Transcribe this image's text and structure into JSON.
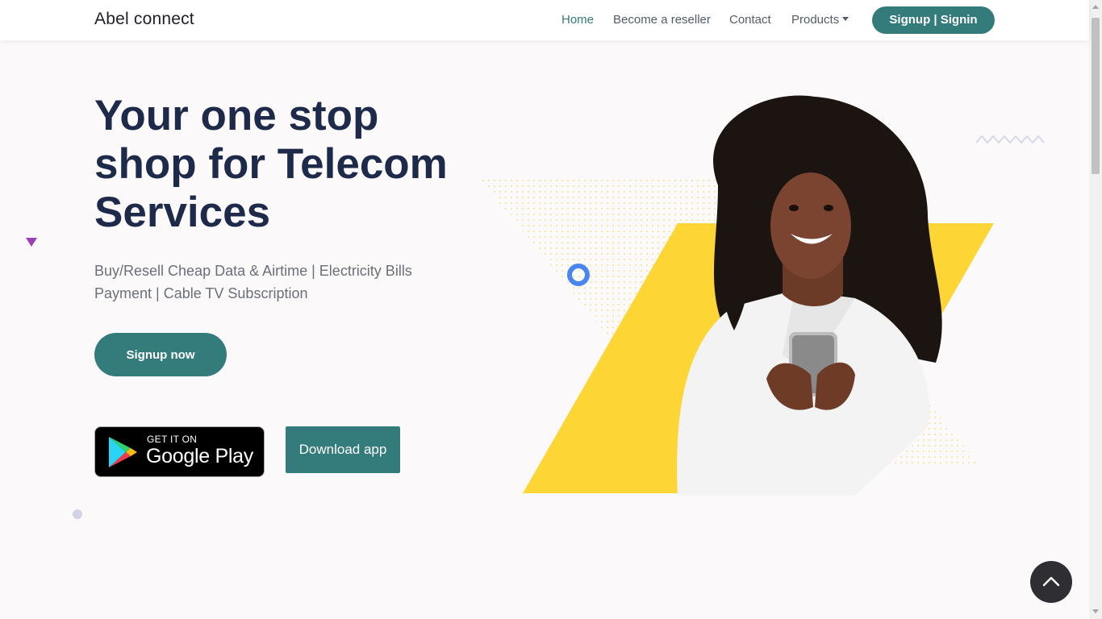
{
  "nav": {
    "brand": "Abel connect",
    "links": [
      {
        "label": "Home",
        "active": true
      },
      {
        "label": "Become a reseller"
      },
      {
        "label": "Contact"
      },
      {
        "label": "Products"
      }
    ],
    "cta": "Signup | Signin"
  },
  "hero": {
    "title_line1": "Your one stop",
    "title_line2": "shop for Telecom",
    "title_line3": "Services",
    "subtitle": "Buy/Resell Cheap Data & Airtime | Electricity Bills Payment | Cable TV Subscription",
    "signup_button": "Signup now",
    "google_play": {
      "small": "GET IT ON",
      "big": "Google Play"
    },
    "download_button": "Download app"
  },
  "colors": {
    "accent": "#347b7b",
    "title": "#1e2a4a",
    "yellow": "#fdd535",
    "ring": "#4a86f0",
    "triangle": "#9b3fb8",
    "dot": "#d4d3e3"
  },
  "icons": {
    "scroll_top": "chevron-up-icon",
    "products_caret": "caret-down-icon"
  }
}
